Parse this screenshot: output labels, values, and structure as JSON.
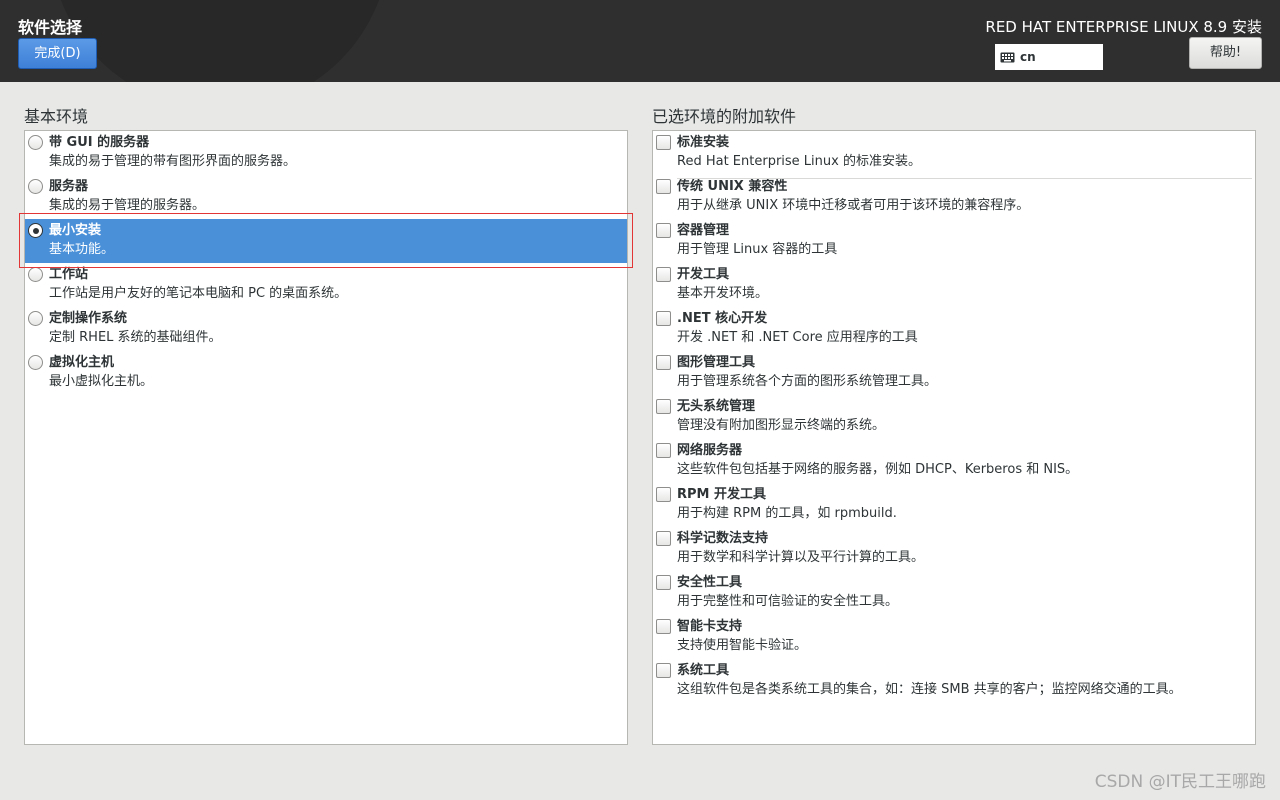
{
  "header": {
    "spoke_title": "软件选择",
    "done_button": "完成(D)",
    "product_title": "RED HAT ENTERPRISE LINUX 8.9 安装",
    "keyboard_layout": "cn",
    "help_button": "帮助!"
  },
  "base_environment": {
    "heading": "基本环境",
    "selected_index": 2,
    "options": [
      {
        "title": "带 GUI 的服务器",
        "description": "集成的易于管理的带有图形界面的服务器。",
        "selected": false
      },
      {
        "title": "服务器",
        "description": "集成的易于管理的服务器。",
        "selected": false
      },
      {
        "title": "最小安装",
        "description": "基本功能。",
        "selected": true
      },
      {
        "title": "工作站",
        "description": "工作站是用户友好的笔记本电脑和 PC 的桌面系统。",
        "selected": false
      },
      {
        "title": "定制操作系统",
        "description": "定制 RHEL 系统的基础组件。",
        "selected": false
      },
      {
        "title": "虚拟化主机",
        "description": "最小虚拟化主机。",
        "selected": false
      }
    ]
  },
  "addons": {
    "heading": "已选环境的附加软件",
    "items": [
      {
        "title": "标准安装",
        "description": "Red Hat Enterprise Linux 的标准安装。",
        "checked": false
      },
      {
        "title": "传统 UNIX 兼容性",
        "description": "用于从继承 UNIX 环境中迁移或者可用于该环境的兼容程序。",
        "checked": false
      },
      {
        "title": "容器管理",
        "description": "用于管理 Linux 容器的工具",
        "checked": false
      },
      {
        "title": "开发工具",
        "description": "基本开发环境。",
        "checked": false
      },
      {
        "title": ".NET 核心开发",
        "description": "开发 .NET 和 .NET Core 应用程序的工具",
        "checked": false
      },
      {
        "title": "图形管理工具",
        "description": "用于管理系统各个方面的图形系统管理工具。",
        "checked": false
      },
      {
        "title": "无头系统管理",
        "description": "管理没有附加图形显示终端的系统。",
        "checked": false
      },
      {
        "title": "网络服务器",
        "description": "这些软件包包括基于网络的服务器，例如 DHCP、Kerberos 和 NIS。",
        "checked": false
      },
      {
        "title": "RPM 开发工具",
        "description": "用于构建 RPM 的工具，如 rpmbuild.",
        "checked": false
      },
      {
        "title": "科学记数法支持",
        "description": "用于数学和科学计算以及平行计算的工具。",
        "checked": false
      },
      {
        "title": "安全性工具",
        "description": "用于完整性和可信验证的安全性工具。",
        "checked": false
      },
      {
        "title": "智能卡支持",
        "description": "支持使用智能卡验证。",
        "checked": false
      },
      {
        "title": "系统工具",
        "description": "这组软件包是各类系统工具的集合，如：连接 SMB 共享的客户；监控网络交通的工具。",
        "checked": false
      }
    ]
  },
  "watermark": "CSDN @IT民工王哪跑",
  "colors": {
    "header_bg": "#2f2f2f",
    "accent": "#4a90d9",
    "highlight_border": "#e23535",
    "page_bg": "#e8e8e7"
  }
}
